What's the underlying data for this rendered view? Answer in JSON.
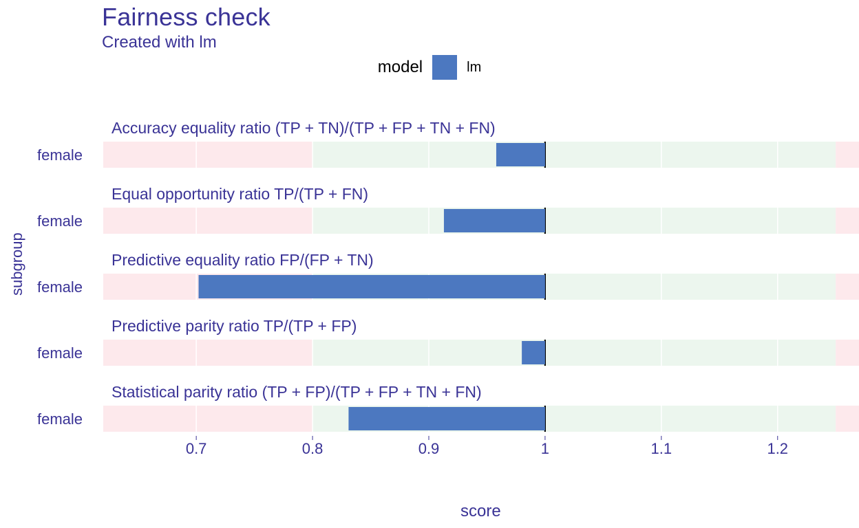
{
  "title": "Fairness check",
  "subtitle": "Created with lm",
  "legend": {
    "title": "model",
    "label": "lm"
  },
  "ylabel": "subgroup",
  "xlabel": "score",
  "colors": {
    "ink": "#3a3396",
    "bar": "#4c78c0",
    "pink": "#fde9ec",
    "green": "#ecf6ee",
    "grid": "#ffffff",
    "centerline": "#000000"
  },
  "axis": {
    "min": 0.62,
    "max": 1.27,
    "ticks": [
      0.7,
      0.8,
      0.9,
      1.0,
      1.1,
      1.2
    ],
    "fair_low": 0.8,
    "fair_high": 1.25,
    "center": 1.0
  },
  "panels": [
    {
      "label": "Accuracy equality ratio     (TP + TN)/(TP + FP + TN + FN)",
      "subgroup": "female",
      "value": 0.958
    },
    {
      "label": "Equal opportunity ratio     TP/(TP + FN)",
      "subgroup": "female",
      "value": 0.913
    },
    {
      "label": "Predictive equality ratio   FP/(FP + TN)",
      "subgroup": "female",
      "value": 0.702
    },
    {
      "label": "Predictive parity ratio      TP/(TP + FP)",
      "subgroup": "female",
      "value": 0.98
    },
    {
      "label": "Statistical parity ratio     (TP + FP)/(TP + FP + TN + FN)",
      "subgroup": "female",
      "value": 0.831
    }
  ],
  "chart_data": {
    "type": "bar",
    "title": "Fairness check",
    "subtitle": "Created with lm",
    "xlabel": "score",
    "ylabel": "subgroup",
    "xlim": [
      0.62,
      1.27
    ],
    "x_ticks": [
      0.7,
      0.8,
      0.9,
      1.0,
      1.1,
      1.2
    ],
    "reference": 1.0,
    "fair_range": [
      0.8,
      1.25
    ],
    "legend": {
      "title": "model",
      "entries": [
        "lm"
      ],
      "position": "top"
    },
    "facets": [
      {
        "title": "Accuracy equality ratio     (TP + TN)/(TP + FP + TN + FN)",
        "categories": [
          "female"
        ],
        "series": [
          {
            "name": "lm",
            "values": [
              0.958
            ]
          }
        ]
      },
      {
        "title": "Equal opportunity ratio     TP/(TP + FN)",
        "categories": [
          "female"
        ],
        "series": [
          {
            "name": "lm",
            "values": [
              0.913
            ]
          }
        ]
      },
      {
        "title": "Predictive equality ratio   FP/(FP + TN)",
        "categories": [
          "female"
        ],
        "series": [
          {
            "name": "lm",
            "values": [
              0.702
            ]
          }
        ]
      },
      {
        "title": "Predictive parity ratio      TP/(TP + FP)",
        "categories": [
          "female"
        ],
        "series": [
          {
            "name": "lm",
            "values": [
              0.98
            ]
          }
        ]
      },
      {
        "title": "Statistical parity ratio     (TP + FP)/(TP + FP + TN + FN)",
        "categories": [
          "female"
        ],
        "series": [
          {
            "name": "lm",
            "values": [
              0.831
            ]
          }
        ]
      }
    ]
  }
}
